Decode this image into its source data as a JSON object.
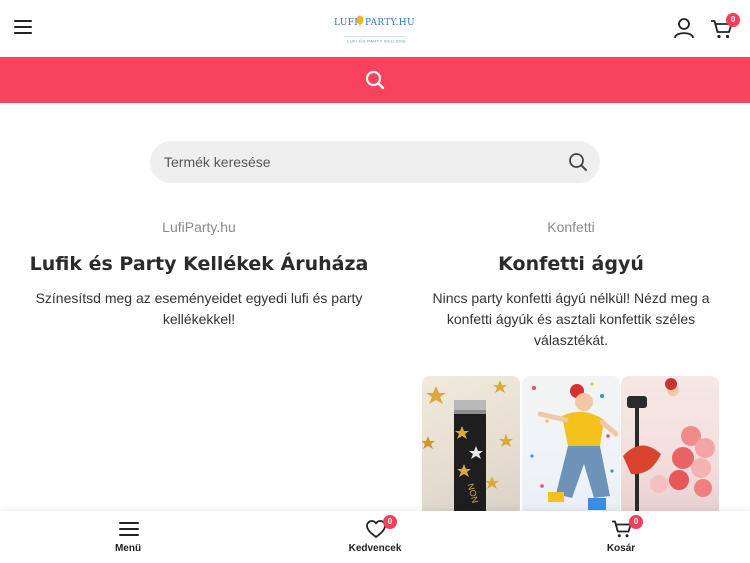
{
  "header": {
    "logo_text": "LUFI PARTY.HU",
    "logo_tagline": "LUFI ÉS PARTY KELLÉKEK",
    "cart_count": "0"
  },
  "search": {
    "placeholder": "Termék keresése"
  },
  "left_block": {
    "subtitle": "LufiParty.hu",
    "title": "Lufik és Party Kellékek Áruháza",
    "description": "Színesítsd meg az eseményeidet egyedi lufi és party kellékekkel!"
  },
  "right_block": {
    "subtitle": "Konfetti",
    "title": "Konfetti ágyú",
    "description": "Nincs party konfetti ágyú nélkül! Nézd meg a konfetti ágyúk és asztali konfettik széles választékát."
  },
  "bottom_nav": {
    "menu_label": "Menü",
    "wishlist_label": "Kedvencek",
    "wishlist_count": "0",
    "cart_label": "Kosár",
    "cart_count": "0"
  },
  "colors": {
    "accent": "#f7435e",
    "badge": "#f43e5a"
  }
}
